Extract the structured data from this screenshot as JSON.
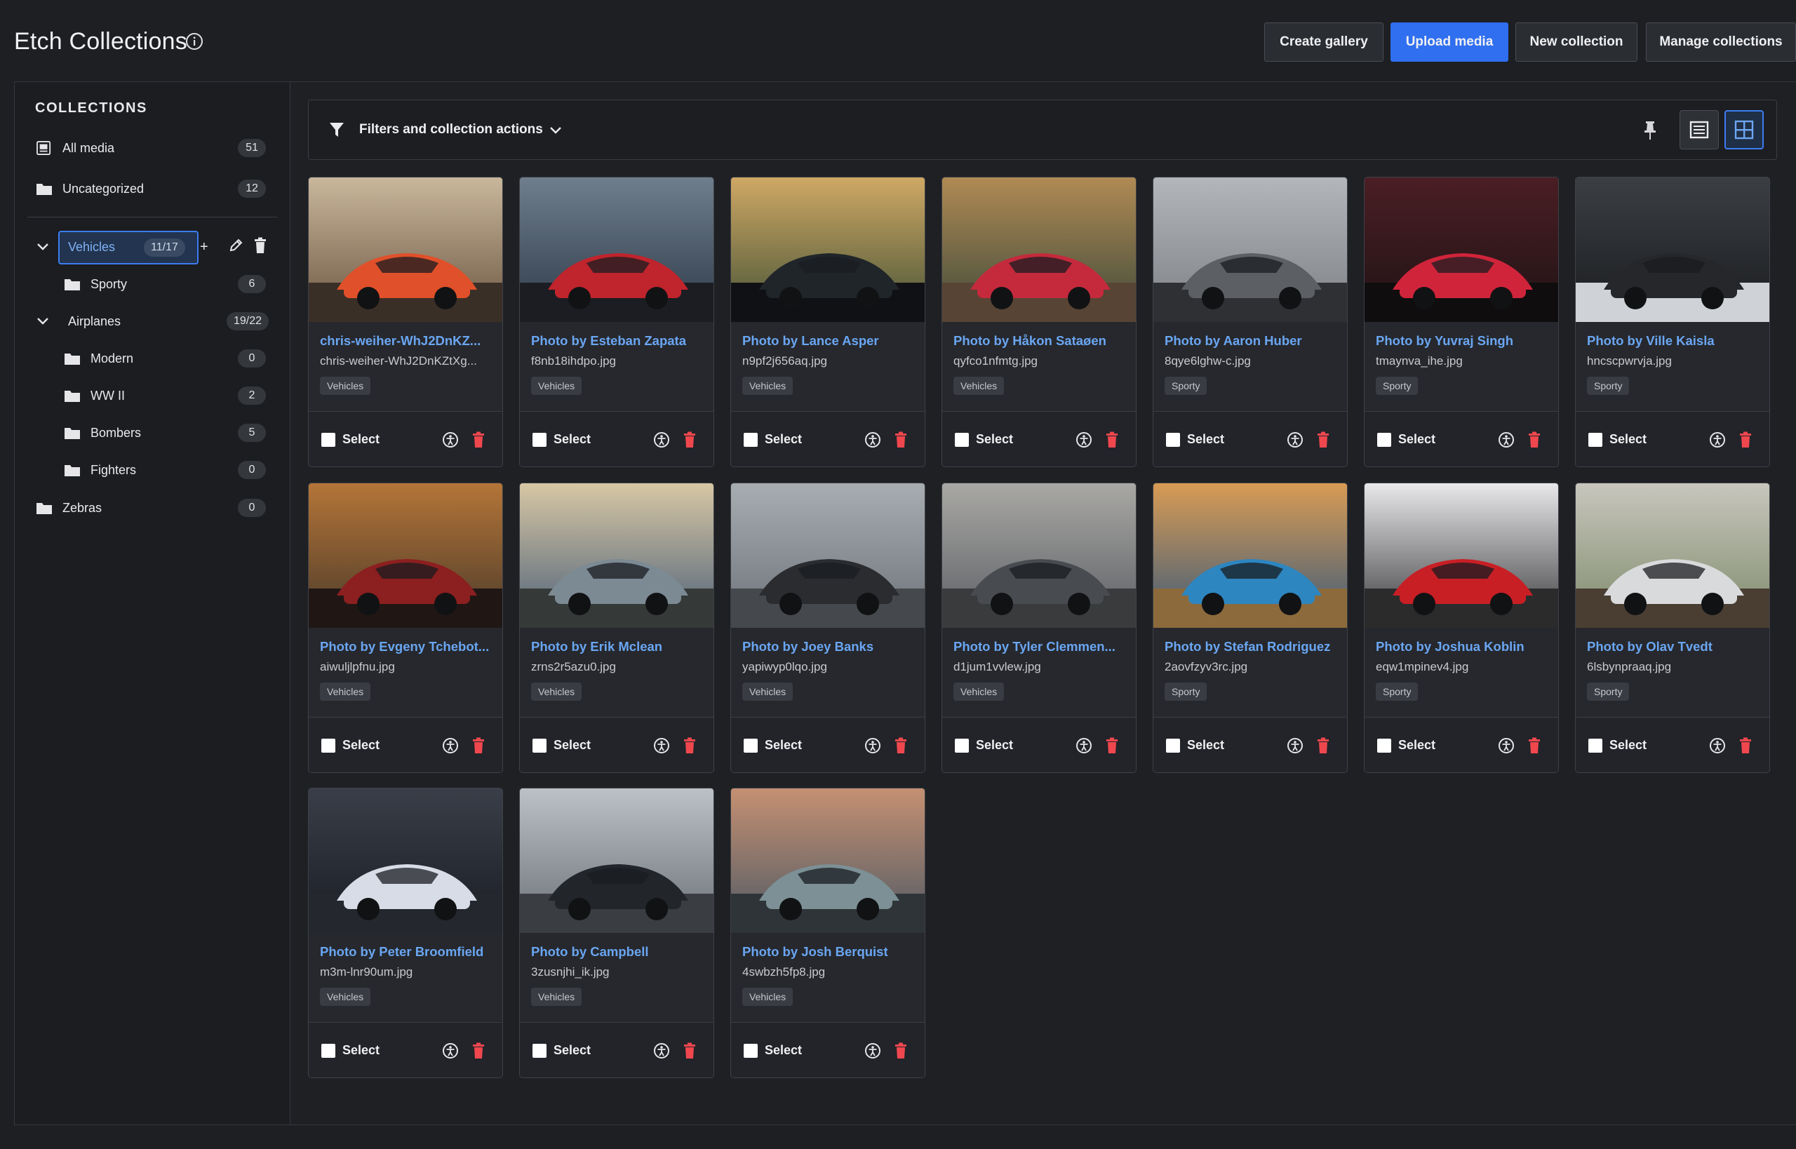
{
  "header": {
    "title": "Etch Collections",
    "buttons": {
      "create_gallery": "Create gallery",
      "upload_media": "Upload media",
      "new_collection": "New collection",
      "manage_collections": "Manage collections"
    }
  },
  "sidebar": {
    "heading": "COLLECTIONS",
    "all_media": {
      "label": "All media",
      "count": "51"
    },
    "uncategorized": {
      "label": "Uncategorized",
      "count": "12"
    },
    "vehicles": {
      "label": "Vehicles",
      "count": "11/17",
      "add": "+"
    },
    "sporty": {
      "label": "Sporty",
      "count": "6"
    },
    "airplanes": {
      "label": "Airplanes",
      "count": "19/22"
    },
    "modern": {
      "label": "Modern",
      "count": "0"
    },
    "ww2": {
      "label": "WW II",
      "count": "2"
    },
    "bombers": {
      "label": "Bombers",
      "count": "5"
    },
    "fighters": {
      "label": "Fighters",
      "count": "0"
    },
    "zebras": {
      "label": "Zebras",
      "count": "0"
    }
  },
  "toolbar": {
    "filter_label": "Filters and collection actions",
    "icons": [
      "filter-icon",
      "chevron-down-icon",
      "pin-icon",
      "list-view-icon",
      "grid-view-icon"
    ]
  },
  "select_label": "Select",
  "cards": [
    {
      "title": "chris-weiher-WhJ2DnKZ...",
      "file": "chris-weiher-WhJ2DnKZtXg...",
      "tag": "Vehicles"
    },
    {
      "title": "Photo by Esteban Zapata",
      "file": "f8nb18ihdpo.jpg",
      "tag": "Vehicles"
    },
    {
      "title": "Photo by Lance Asper",
      "file": "n9pf2j656aq.jpg",
      "tag": "Vehicles"
    },
    {
      "title": "Photo by Håkon Sataøen",
      "file": "qyfco1nfmtg.jpg",
      "tag": "Vehicles"
    },
    {
      "title": "Photo by Aaron Huber",
      "file": "8qye6lghw-c.jpg",
      "tag": "Sporty"
    },
    {
      "title": "Photo by Yuvraj Singh",
      "file": "tmaynva_ihe.jpg",
      "tag": "Sporty"
    },
    {
      "title": "Photo by Ville Kaisla",
      "file": "hncscpwrvja.jpg",
      "tag": "Sporty"
    },
    {
      "title": "Photo by Evgeny Tchebot...",
      "file": "aiwuljlpfnu.jpg",
      "tag": "Vehicles"
    },
    {
      "title": "Photo by Erik Mclean",
      "file": "zrns2r5azu0.jpg",
      "tag": "Vehicles"
    },
    {
      "title": "Photo by Joey Banks",
      "file": "yapiwyp0lqo.jpg",
      "tag": "Vehicles"
    },
    {
      "title": "Photo by Tyler Clemmen...",
      "file": "d1jum1vvlew.jpg",
      "tag": "Vehicles"
    },
    {
      "title": "Photo by Stefan Rodriguez",
      "file": "2aovfzyv3rc.jpg",
      "tag": "Sporty"
    },
    {
      "title": "Photo by Joshua Koblin",
      "file": "eqw1mpinev4.jpg",
      "tag": "Sporty"
    },
    {
      "title": "Photo by Olav Tvedt",
      "file": "6lsbynpraaq.jpg",
      "tag": "Sporty"
    },
    {
      "title": "Photo by Peter Broomfield",
      "file": "m3m-lnr90um.jpg",
      "tag": "Vehicles"
    },
    {
      "title": "Photo by Campbell",
      "file": "3zusnjhi_ik.jpg",
      "tag": "Vehicles"
    },
    {
      "title": "Photo by Josh Berquist",
      "file": "4swbzh5fp8.jpg",
      "tag": "Vehicles"
    }
  ]
}
